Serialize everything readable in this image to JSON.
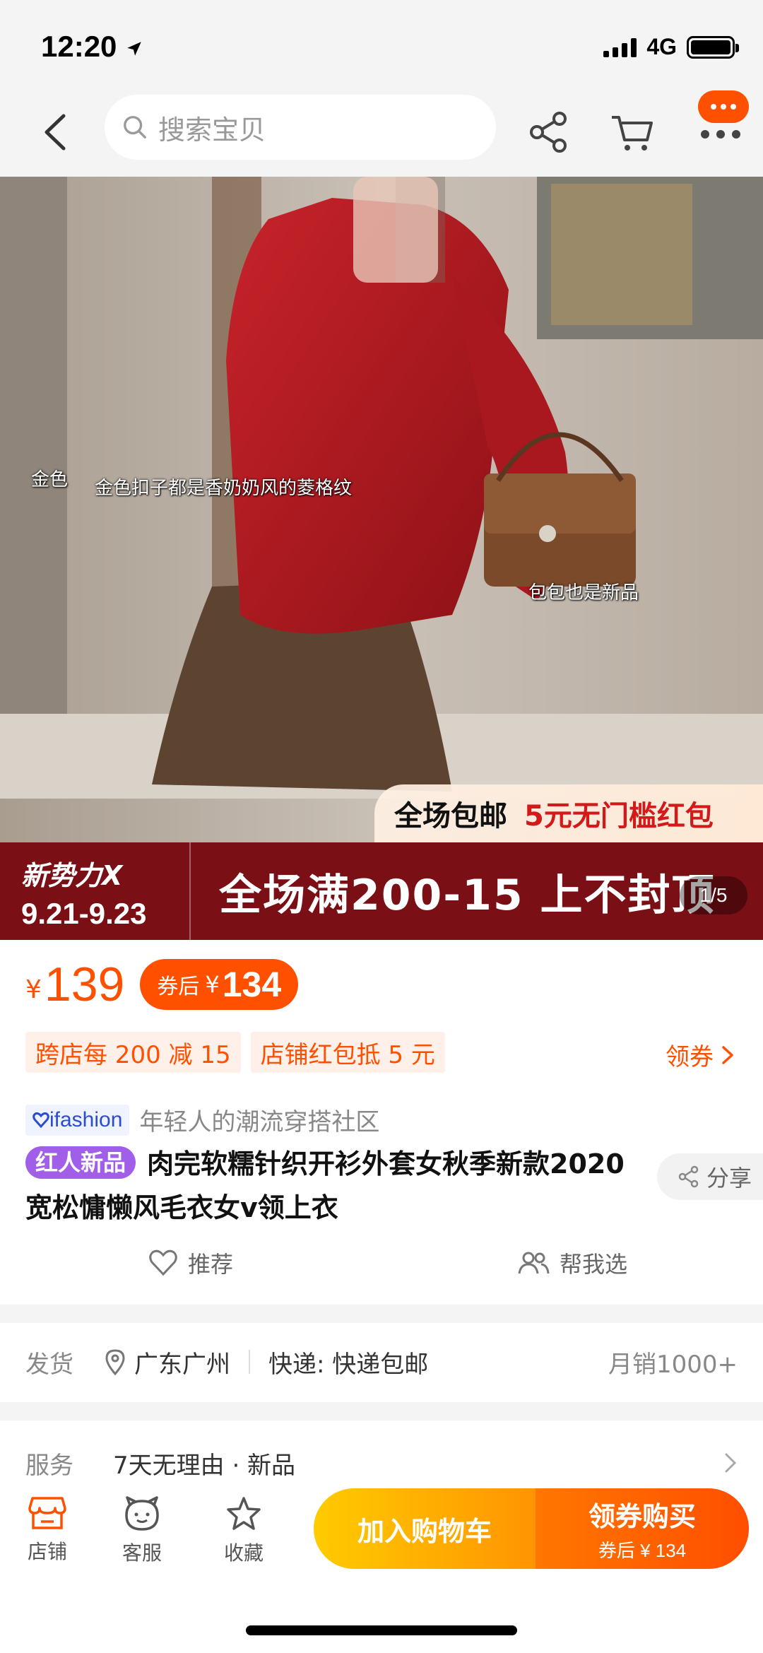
{
  "status": {
    "time": "12:20",
    "network": "4G"
  },
  "nav": {
    "search_placeholder": "搜索宝贝"
  },
  "hero": {
    "overlay_left_partial": "金色",
    "overlay_caption_1": "金色扣子都是香奶奶风的菱格纹",
    "overlay_caption_2": "包包也是新品",
    "promo_free_shipping": "全场包邮",
    "promo_red_packet": "5元无门槛红包",
    "band_brand": "新势力X",
    "band_dates": "9.21-9.23",
    "band_main": "全场满200-15 上不封顶",
    "pager": "1/5"
  },
  "price": {
    "currency": "¥",
    "price": "139",
    "coupon_label": "券后",
    "coupon_price": "134"
  },
  "promos": {
    "tags": [
      "跨店每 200 减 15",
      "店铺红包抵 5 元"
    ],
    "claim": "领券"
  },
  "brand": {
    "logo_text": "ifashion",
    "slogan": "年轻人的潮流穿搭社区"
  },
  "product": {
    "badge": "红人新品",
    "title": "肉完软糯针织开衫外套女秋季新款2020宽松慵懒风毛衣女v领上衣",
    "share": "分享"
  },
  "actions": {
    "recommend": "推荐",
    "help_choose": "帮我选"
  },
  "shipping": {
    "label": "发货",
    "location": "广东广州",
    "express": "快递: 快递包邮",
    "monthly_sales": "月销1000+"
  },
  "service": {
    "label": "服务",
    "value": "7天无理由 · 新品"
  },
  "bottom": {
    "store": "店铺",
    "support": "客服",
    "favorite": "收藏",
    "add_to_cart": "加入购物车",
    "buy_label": "领券购买",
    "buy_sub": "券后 ¥ 134"
  },
  "colors": {
    "accent": "#ff5000",
    "badge_purple": "#a15ee8",
    "band_red": "#7a0f15"
  }
}
